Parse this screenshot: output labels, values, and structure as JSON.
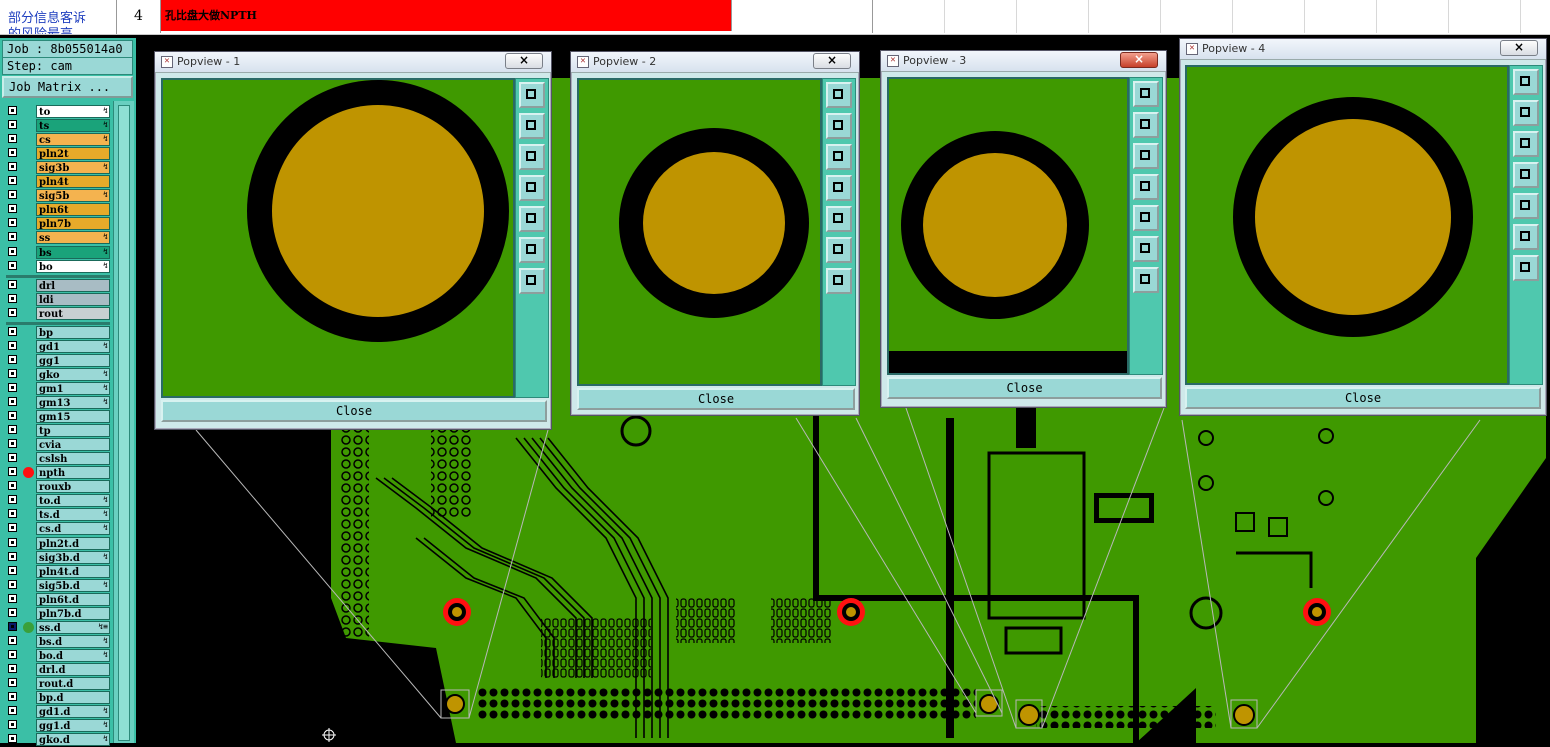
{
  "sheet": {
    "cell_text": "部分信息客诉",
    "cell_text_line3": "的风险最高",
    "row_number": "4",
    "red_cell": "孔比盘大做NPTH"
  },
  "left_panel": {
    "job_label": "Job : 8b055014a0",
    "step_label": "Step: cam",
    "matrix_button": "Job Matrix ...",
    "layers": [
      {
        "name": "to",
        "color": "#ffffff",
        "flag": "↯"
      },
      {
        "name": "ts",
        "color": "#1aa37a",
        "flag": "↯"
      },
      {
        "name": "cs",
        "color": "#f4b34f",
        "flag": "↯"
      },
      {
        "name": "pln2t",
        "color": "#e6aa2a",
        "flag": ""
      },
      {
        "name": "sig3b",
        "color": "#f4b34f",
        "flag": "↯"
      },
      {
        "name": "pln4t",
        "color": "#e6aa2a",
        "flag": ""
      },
      {
        "name": "sig5b",
        "color": "#f4b34f",
        "flag": "↯"
      },
      {
        "name": "pln6t",
        "color": "#e6aa2a",
        "flag": ""
      },
      {
        "name": "pln7b",
        "color": "#e6aa2a",
        "flag": ""
      },
      {
        "name": "ss",
        "color": "#f4b34f",
        "flag": "↯"
      },
      {
        "name": "bs",
        "color": "#1aa37a",
        "flag": "↯"
      },
      {
        "name": "bo",
        "color": "#ffffff",
        "flag": "↯"
      },
      {
        "name": "drl",
        "color": "#a8bcc4",
        "flag": ""
      },
      {
        "name": "ldi",
        "color": "#a8bcc4",
        "flag": ""
      },
      {
        "name": "rout",
        "color": "#c8d0d2",
        "flag": ""
      },
      {
        "name": "bp",
        "color": "#9ad8d6",
        "flag": ""
      },
      {
        "name": "gd1",
        "color": "#9ad8d6",
        "flag": "↯"
      },
      {
        "name": "gg1",
        "color": "#9ad8d6",
        "flag": ""
      },
      {
        "name": "gko",
        "color": "#9ad8d6",
        "flag": "↯"
      },
      {
        "name": "gm1",
        "color": "#9ad8d6",
        "flag": "↯"
      },
      {
        "name": "gm13",
        "color": "#9ad8d6",
        "flag": "↯"
      },
      {
        "name": "gm15",
        "color": "#9ad8d6",
        "flag": ""
      },
      {
        "name": "tp",
        "color": "#9ad8d6",
        "flag": ""
      },
      {
        "name": "cvia",
        "color": "#9ad8d6",
        "flag": ""
      },
      {
        "name": "cslsh",
        "color": "#9ad8d6",
        "flag": ""
      },
      {
        "name": "npth",
        "color": "#9ad8d6",
        "flag": ""
      },
      {
        "name": "rouxb",
        "color": "#9ad8d6",
        "flag": ""
      },
      {
        "name": "to.d",
        "color": "#9ad8d6",
        "flag": "↯"
      },
      {
        "name": "ts.d",
        "color": "#9ad8d6",
        "flag": "↯"
      },
      {
        "name": "cs.d",
        "color": "#9ad8d6",
        "flag": "↯"
      },
      {
        "name": "pln2t.d",
        "color": "#9ad8d6",
        "flag": ""
      },
      {
        "name": "sig3b.d",
        "color": "#9ad8d6",
        "flag": "↯"
      },
      {
        "name": "pln4t.d",
        "color": "#9ad8d6",
        "flag": ""
      },
      {
        "name": "sig5b.d",
        "color": "#9ad8d6",
        "flag": "↯"
      },
      {
        "name": "pln6t.d",
        "color": "#9ad8d6",
        "flag": ""
      },
      {
        "name": "pln7b.d",
        "color": "#9ad8d6",
        "flag": ""
      },
      {
        "name": "ss.d",
        "color": "#9ad8d6",
        "flag": "↯≡"
      },
      {
        "name": "bs.d",
        "color": "#9ad8d6",
        "flag": "↯"
      },
      {
        "name": "bo.d",
        "color": "#9ad8d6",
        "flag": "↯"
      },
      {
        "name": "drl.d",
        "color": "#9ad8d6",
        "flag": ""
      },
      {
        "name": "rout.d",
        "color": "#9ad8d6",
        "flag": ""
      },
      {
        "name": "bp.d",
        "color": "#9ad8d6",
        "flag": ""
      },
      {
        "name": "gd1.d",
        "color": "#9ad8d6",
        "flag": "↯"
      },
      {
        "name": "gg1.d",
        "color": "#9ad8d6",
        "flag": "↯"
      },
      {
        "name": "gko.d",
        "color": "#9ad8d6",
        "flag": "↯"
      }
    ]
  },
  "popviews": [
    {
      "title": "Popview - 1",
      "close_label": "Close",
      "close_x": "×"
    },
    {
      "title": "Popview - 2",
      "close_label": "Close",
      "close_x": "×"
    },
    {
      "title": "Popview - 3",
      "close_label": "Close",
      "close_x": "×"
    },
    {
      "title": "Popview - 4",
      "close_label": "Close",
      "close_x": "×"
    }
  ],
  "colors": {
    "board_green": "#3f9900",
    "pad_gold": "#bf9400",
    "panel_teal": "#3bbfa6",
    "npth_marker": "#ff1111",
    "ss_marker": "#3aa03a"
  }
}
